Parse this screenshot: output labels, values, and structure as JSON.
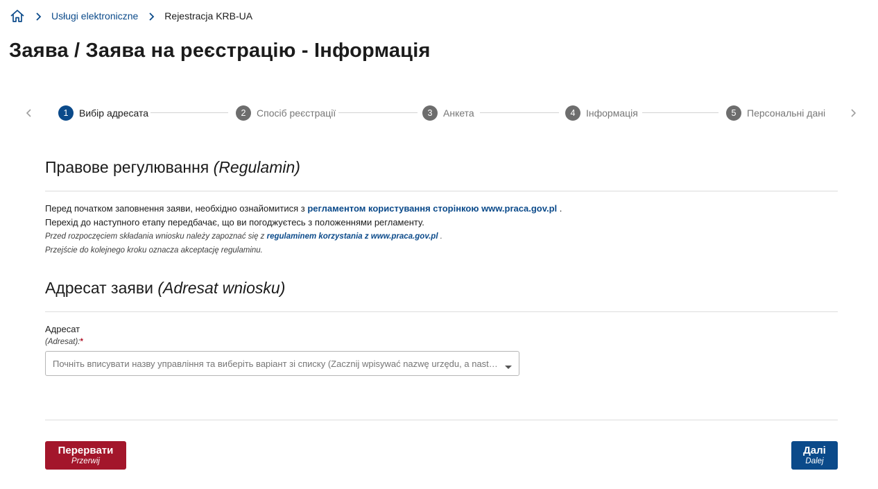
{
  "breadcrumb": {
    "home_icon": "home-icon",
    "items": [
      {
        "label": "Usługi elektroniczne"
      },
      {
        "label": "Rejestracja KRB-UA"
      }
    ]
  },
  "page_title": "Заява / Заява на реєстрацію - Інформація",
  "stepper": {
    "steps": [
      {
        "number": "1",
        "label": "Вибір адресата",
        "active": true
      },
      {
        "number": "2",
        "label": "Спосіб реєстрації",
        "active": false
      },
      {
        "number": "3",
        "label": "Анкета",
        "active": false
      },
      {
        "number": "4",
        "label": "Інформація",
        "active": false
      },
      {
        "number": "5",
        "label": "Персональні дані",
        "active": false
      }
    ]
  },
  "regulation": {
    "title": "Правове регулювання",
    "title_pl": "(Regulamin)",
    "line1_before": "Перед початком заповнення заяви, необхідно ознайомитися з ",
    "line1_link": "регламентом користування сторінкою www.praca.gov.pl",
    "line1_after": " .",
    "line2": "Перехід до наступного етапу передбачає, що ви погоджуєтесь з положеннями регламенту.",
    "line3_before": "Przed rozpoczęciem składania wniosku należy zapoznać się z ",
    "line3_link": "regulaminem korzystania z www.praca.gov.pl",
    "line3_after": " .",
    "line4": "Przejście do kolejnego kroku oznacza akceptację regulaminu."
  },
  "addressee": {
    "title": "Адресат заяви",
    "title_pl": "(Adresat wniosku)",
    "field_label": "Адресат",
    "field_label_pl": "(Adresat):",
    "required_mark": "*",
    "placeholder": "Почніть вписувати назву управління та виберіть варіант зі списку (Zacznij wpisywać nazwę urzędu, a następnie wybierz z listy)"
  },
  "buttons": {
    "cancel_label": "Перервати",
    "cancel_label_pl": "Przerwij",
    "next_label": "Далі",
    "next_label_pl": "Dalej"
  },
  "colors": {
    "primary": "#0b4a8a",
    "danger": "#a3162b",
    "step_inactive": "#6d6d6d"
  }
}
